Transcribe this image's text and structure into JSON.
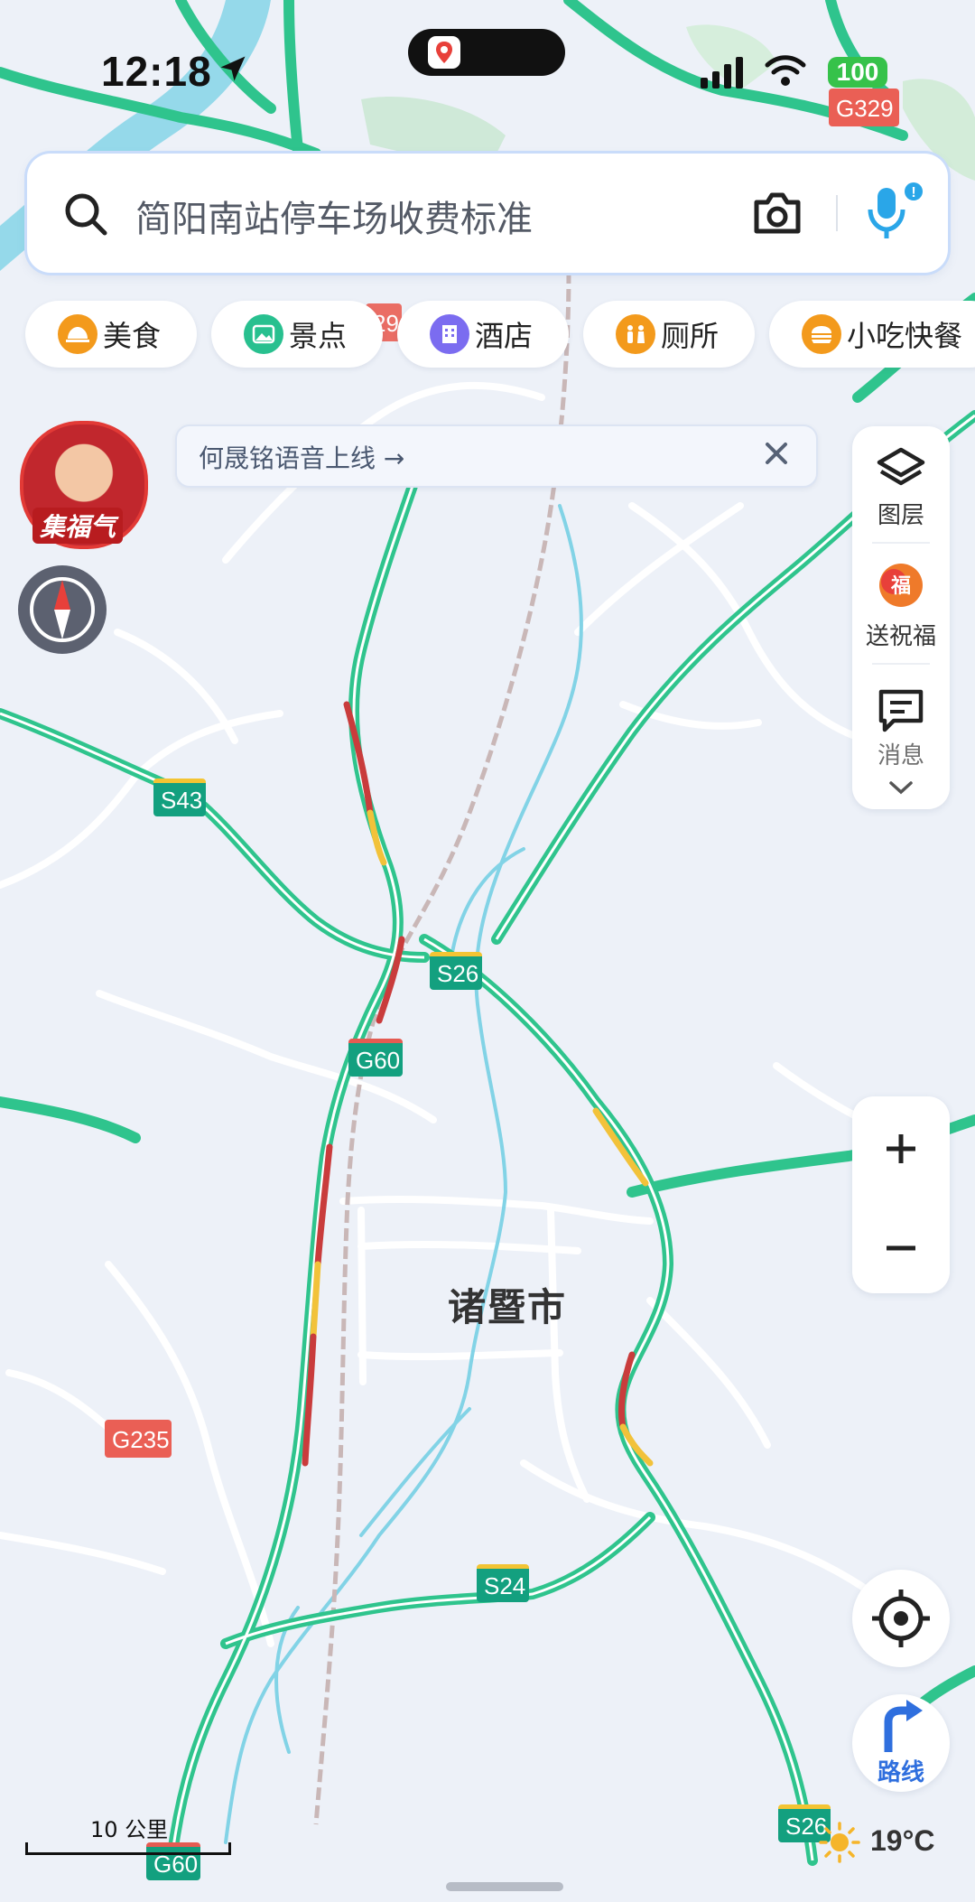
{
  "status_bar": {
    "time": "12:18",
    "battery": "100"
  },
  "search": {
    "query": "简阳南站停车场收费标准"
  },
  "categories": [
    {
      "label": "美食",
      "icon": "food-icon",
      "color": "#f39a1c"
    },
    {
      "label": "景点",
      "icon": "scenic-icon",
      "color": "#28c08f"
    },
    {
      "label": "酒店",
      "icon": "hotel-icon",
      "color": "#7b6cf0"
    },
    {
      "label": "厕所",
      "icon": "toilet-icon",
      "color": "#f39a1c"
    },
    {
      "label": "小吃快餐",
      "icon": "snack-icon",
      "color": "#f39a1c"
    }
  ],
  "banner": {
    "text": "何晟铭语音上线 →"
  },
  "avatar": {
    "label": "集福气"
  },
  "toolbar": {
    "layers": "图层",
    "blessing": "送祝福",
    "messages": "消息"
  },
  "map": {
    "city": "诸暨市",
    "shields": [
      "G329",
      "S43",
      "S26",
      "G60",
      "G235",
      "S24",
      "S26",
      "G60",
      "29"
    ],
    "scale": "10 公里",
    "colors": {
      "expressway": "#2fc48d",
      "congested": "#c93c3c",
      "slow": "#f2c23a",
      "national_road": "#ea5f55",
      "river": "#7fd6e6",
      "rail": "#c7b6b6"
    }
  },
  "route": {
    "label": "路线"
  },
  "weather": {
    "temp": "19°C"
  }
}
